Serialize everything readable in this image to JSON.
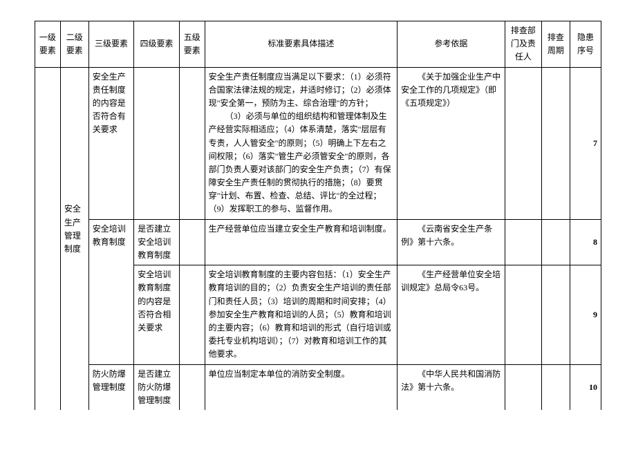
{
  "headers": {
    "c1": "一级要素",
    "c2": "二级要素",
    "c3": "三级要素",
    "c4": "四级要素",
    "c5": "五级要素",
    "c6": "标准要素具体描述",
    "c7": "参考依据",
    "c8": "排查部门及责任人",
    "c9": "排查周期",
    "c10": "隐患序号"
  },
  "group": {
    "l2": "安全生产管理制度"
  },
  "rows": [
    {
      "c3": "安全生产责任制度的内容是否符合有关要求",
      "c4": "",
      "c6": "安全生产责任制度应当满足以下要求：（1）必须符合国家法律法规的规定，并适时修订；（2）必须体现\"安全第一，预防为主、综合治理\"的方针；",
      "c6b": "（3）必须与单位的组织结构和管理体制及生产经营实际相适应；（4）体系清楚，落实\"层层有专责，人人管安全\"的原则；（5）明确上下左右之间权限；（6）落实\"管生产必须管安全\"的原则，各部门负责人要对该部门的安全生产负责；（7）有保障安全生产责任制的贯彻执行的措施；（8）要贯穿\"计划、布置、检查、总结、评比\"的全过程；（9）发挥职工的参与、监督作用。",
      "c7": "《关于加强企业生产中安全工作的几项规定》（即《五项规定》）",
      "seq": "7"
    },
    {
      "c3": "安全培训教育制度",
      "c4": "是否建立安全培训教育制度",
      "c6": "生产经营单位应当建立安全生产教育和培训制度。",
      "c7": "《云南省安全生产条例》第十六条。",
      "seq": "8"
    },
    {
      "c3": "",
      "c4": "安全培训教育制度的内容是否符合相关要求",
      "c6": "安全培训教育制度的主要内容包括：（1）安全生产教育培训的目的；（2）负责安全生产培训的责任部门和责任人员；（3）培训的周期和时间安排；（4）参加安全生产教育和培训的人员；（5）教育和培训的主要内容；（6）教育和培训的形式（自行培训或委托专业机构培训）；（7）对教育和培训工作的其他要求。",
      "c7": "《生产经营单位安全培训规定》总局令63号。",
      "seq": "9"
    },
    {
      "c3": "防火防爆管理制度",
      "c4": "是否建立防火防爆管理制度",
      "c6": "单位应当制定本单位的消防安全制度。",
      "c7": "《中华人民共和国消防法》第十六条。",
      "seq": "10"
    }
  ]
}
